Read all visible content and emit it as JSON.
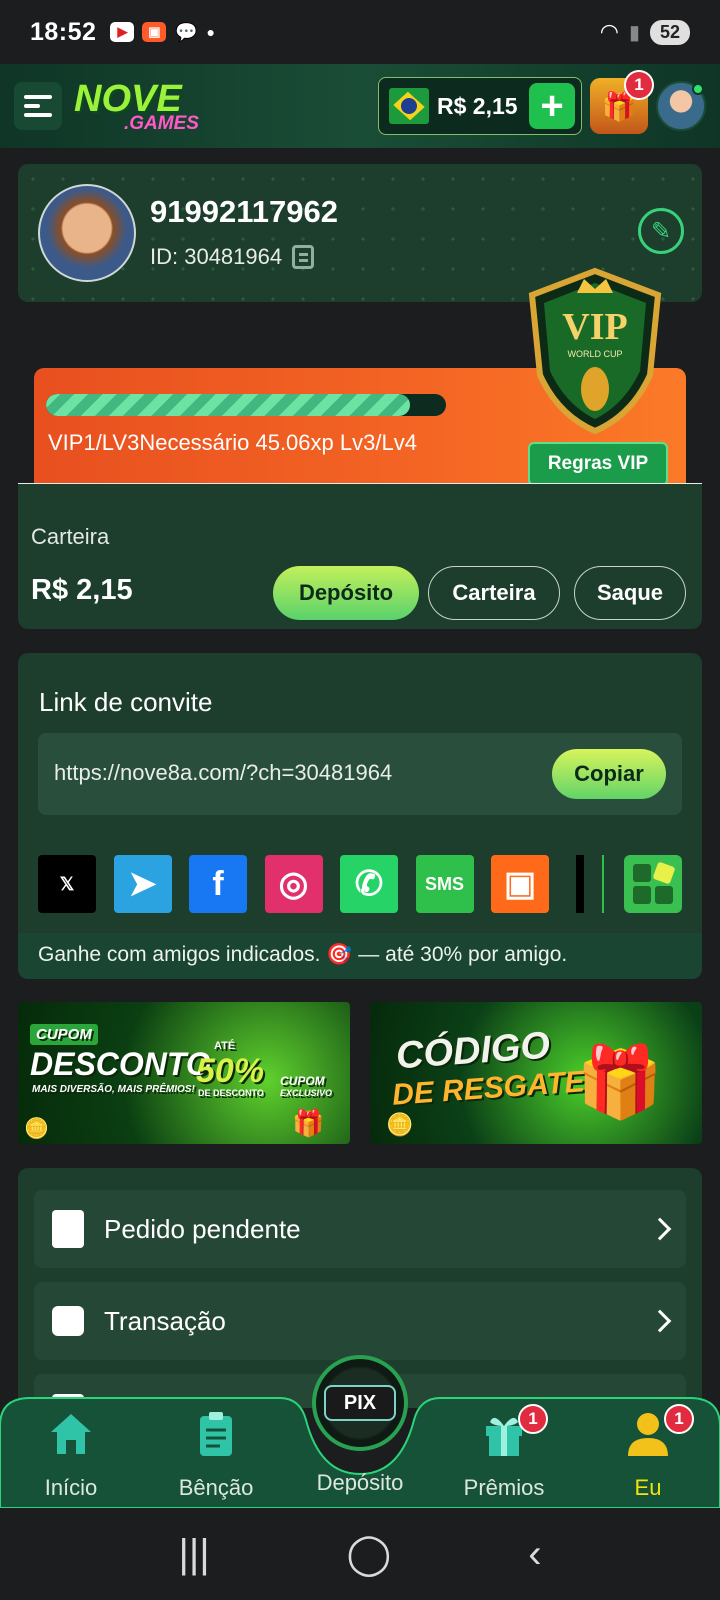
{
  "status_bar": {
    "time": "18:52",
    "battery": "52"
  },
  "header": {
    "logo_main": "NOVE",
    "logo_sub": ".GAMES",
    "balance": "R$ 2,15",
    "add_label": "+",
    "rewards_badge": "1"
  },
  "profile": {
    "name": "91992117962",
    "id_text": "ID: 30481964"
  },
  "vip": {
    "progress_fraction": 0.91,
    "status_text": "VIP1/LV3Necessário 45.06xp Lv3/Lv4",
    "rules_label": "Regras VIP",
    "shield_title": "VIP",
    "shield_sub": "WORLD CUP"
  },
  "wallet": {
    "label": "Carteira",
    "amount": "R$ 2,15",
    "deposit": "Depósito",
    "wallet": "Carteira",
    "withdraw": "Saque"
  },
  "invite": {
    "title": "Link de convite",
    "url": "https://nove8a.com/?ch=30481964",
    "copy": "Copiar",
    "footer": "Ganhe com amigos indicados. 🎯 — até 30% por amigo."
  },
  "share": [
    {
      "icon": "x-icon",
      "glyph": "𝕏",
      "color": "#000000"
    },
    {
      "icon": "telegram-icon",
      "glyph": "➤",
      "color": "#2aa3e0"
    },
    {
      "icon": "facebook-icon",
      "glyph": "f",
      "color": "#1877f2"
    },
    {
      "icon": "instagram-icon",
      "glyph": "◎",
      "color": "#e1306c"
    },
    {
      "icon": "whatsapp-icon",
      "glyph": "✆",
      "color": "#25d366"
    },
    {
      "icon": "sms-icon",
      "glyph": "SMS",
      "color": "#2ec04a"
    },
    {
      "icon": "kwai-icon",
      "glyph": "▣",
      "color": "#ff6a1a"
    }
  ],
  "banners": {
    "b1": {
      "tag": "CUPOM",
      "title": "DESCONTO",
      "sub": "MAIS DIVERSÃO, MAIS PRÊMIOS!",
      "percent": "50%",
      "ate": "ATÉ",
      "desc": "DE DESCONTO",
      "cupom": "CUPOM",
      "exclusivo": "EXCLUSIVO"
    },
    "b2": {
      "line1": "CÓDIGO",
      "line2": "DE RESGATE"
    }
  },
  "menu": [
    {
      "label": "Pedido pendente"
    },
    {
      "label": "Transação"
    }
  ],
  "nav": {
    "home": "Início",
    "blessing": "Bênção",
    "deposit": "Depósito",
    "prizes": "Prêmios",
    "me": "Eu",
    "prizes_badge": "1",
    "me_badge": "1",
    "pix_label": "PIX"
  },
  "colors": {
    "accent": "#2ee36a",
    "active_tab": "#f2e20f",
    "card": "#1d3d2d"
  }
}
